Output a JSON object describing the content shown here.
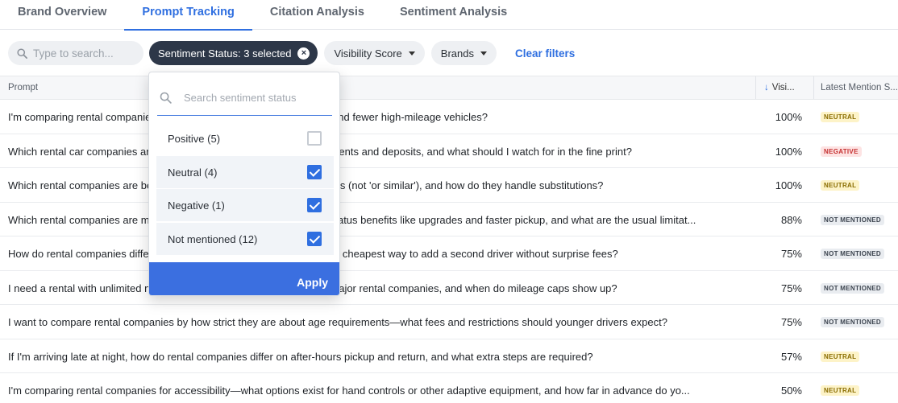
{
  "tabs": [
    {
      "label": "Brand Overview"
    },
    {
      "label": "Prompt Tracking"
    },
    {
      "label": "Citation Analysis"
    },
    {
      "label": "Sentiment Analysis"
    }
  ],
  "active_tab": 1,
  "filters": {
    "search_placeholder": "Type to search...",
    "sentiment_chip": "Sentiment Status: 3 selected",
    "sentiment_clear_glyph": "×",
    "visibility_chip": "Visibility Score",
    "brands_chip": "Brands",
    "clear_filters": "Clear filters"
  },
  "table": {
    "headers": {
      "prompt": "Prompt",
      "visibility": "Visi...",
      "latest": "Latest Mention S..."
    },
    "sort_glyph": "↓",
    "rows": [
      {
        "prompt": "I'm comparing rental companies: which ones tend to have newer cars and fewer high-mileage vehicles?",
        "visibility": "100%",
        "status": "NEUTRAL",
        "status_kind": "neutral"
      },
      {
        "prompt": "Which rental car companies are most flexible about debit card requirements and deposits, and what should I watch for in the fine print?",
        "visibility": "100%",
        "status": "NEGATIVE",
        "status_kind": "negative"
      },
      {
        "prompt": "Which rental companies are best at guaranteeing a specific vehicle class (not 'or similar'), and how do they handle substitutions?",
        "visibility": "100%",
        "status": "NEUTRAL",
        "status_kind": "neutral"
      },
      {
        "prompt": "Which rental companies are most generous with loyalty program and status benefits like upgrades and faster pickup, and what are the usual limitat...",
        "visibility": "88%",
        "status": "NOT MENTIONED",
        "status_kind": "notm"
      },
      {
        "prompt": "How do rental companies differ on additional driver fees, and what's the cheapest way to add a second driver without surprise fees?",
        "visibility": "75%",
        "status": "NOT MENTIONED",
        "status_kind": "notm"
      },
      {
        "prompt": "I need a rental with unlimited mileage: how do policies differ between major rental companies, and when do mileage caps show up?",
        "visibility": "75%",
        "status": "NOT MENTIONED",
        "status_kind": "notm"
      },
      {
        "prompt": "I want to compare rental companies by how strict they are about age requirements—what fees and restrictions should younger drivers expect?",
        "visibility": "75%",
        "status": "NOT MENTIONED",
        "status_kind": "notm"
      },
      {
        "prompt": "If I'm arriving late at night, how do rental companies differ on after-hours pickup and return, and what extra steps are required?",
        "visibility": "57%",
        "status": "NEUTRAL",
        "status_kind": "neutral"
      },
      {
        "prompt": "I'm comparing rental companies for accessibility—what options exist for hand controls or other adaptive equipment, and how far in advance do yo...",
        "visibility": "50%",
        "status": "NEUTRAL",
        "status_kind": "neutral"
      }
    ]
  },
  "dropdown": {
    "search_placeholder": "Search sentiment status",
    "options": [
      {
        "label": "Positive (5)",
        "checked": false
      },
      {
        "label": "Neutral (4)",
        "checked": true
      },
      {
        "label": "Negative (1)",
        "checked": true
      },
      {
        "label": "Not mentioned (12)",
        "checked": true
      }
    ],
    "apply_label": "Apply"
  },
  "colors": {
    "accent": "#2f6fe0",
    "chip_dark": "#2d3748",
    "neutral_badge": "#fdf3c8",
    "negative_badge": "#fde3e3",
    "not_mentioned_badge": "#e9ecf0"
  }
}
